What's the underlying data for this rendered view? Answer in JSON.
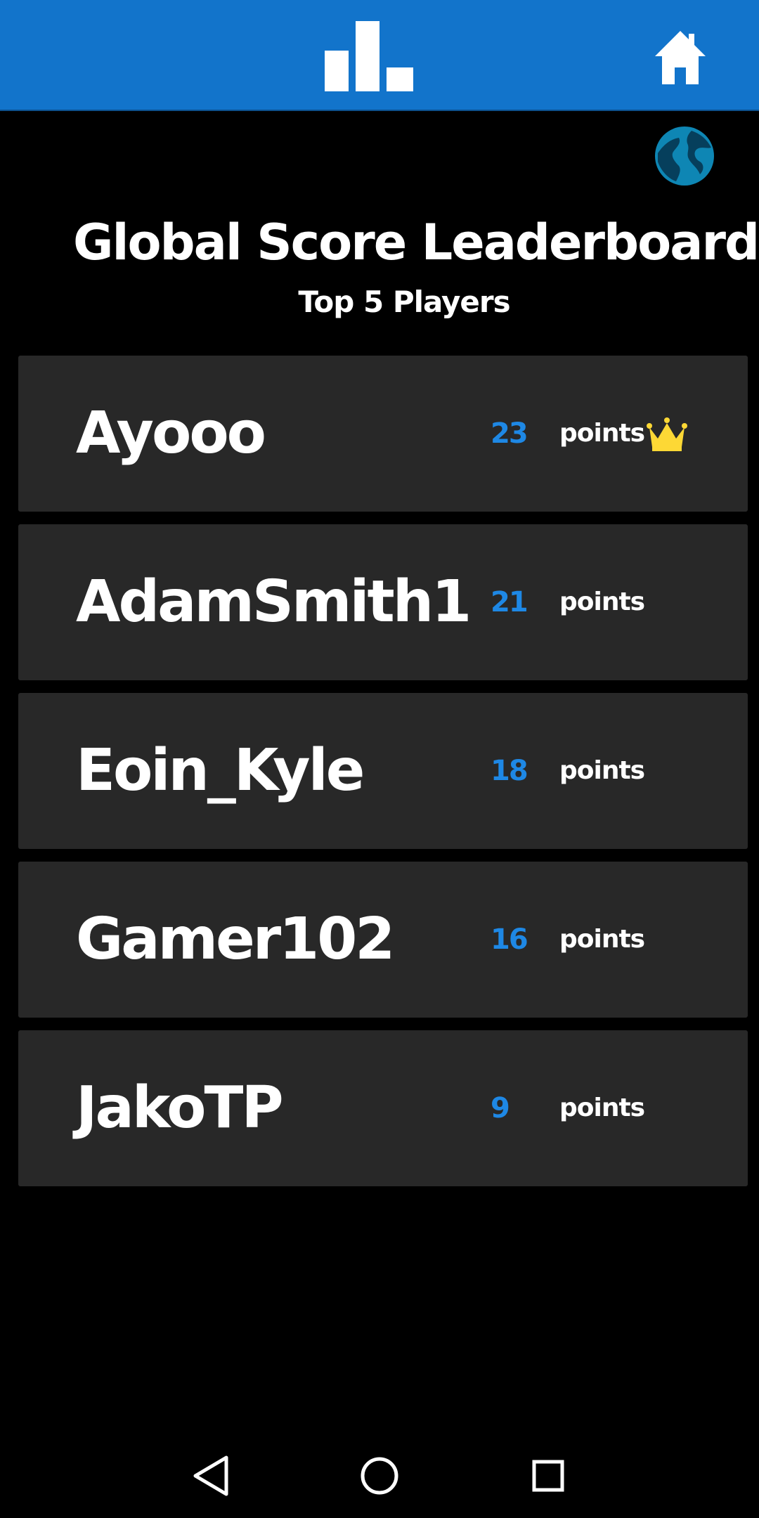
{
  "app_bar": {
    "background_color": "#1274CB",
    "center_icon": "leaderboard-icon",
    "right_icon": "home-icon"
  },
  "globe_icon": "globe-icon",
  "title": "Global Score Leaderboard",
  "subtitle": "Top 5 Players",
  "players": [
    {
      "name": "Ayooo",
      "score": "23",
      "unit": "points",
      "crown": true
    },
    {
      "name": "AdamSmith1",
      "score": "21",
      "unit": "points",
      "crown": false
    },
    {
      "name": "Eoin_Kyle",
      "score": "18",
      "unit": "points",
      "crown": false
    },
    {
      "name": "Gamer102",
      "score": "16",
      "unit": "points",
      "crown": false
    },
    {
      "name": "JakoTP",
      "score": "9",
      "unit": "points",
      "crown": false
    }
  ],
  "colors": {
    "score": "#1E88E5",
    "row_background": "#282828",
    "crown": "#FDD835",
    "globe": "#0E86B4"
  },
  "nav": {
    "back_icon": "back-triangle-icon",
    "home_icon": "home-circle-icon",
    "recents_icon": "recents-square-icon"
  }
}
